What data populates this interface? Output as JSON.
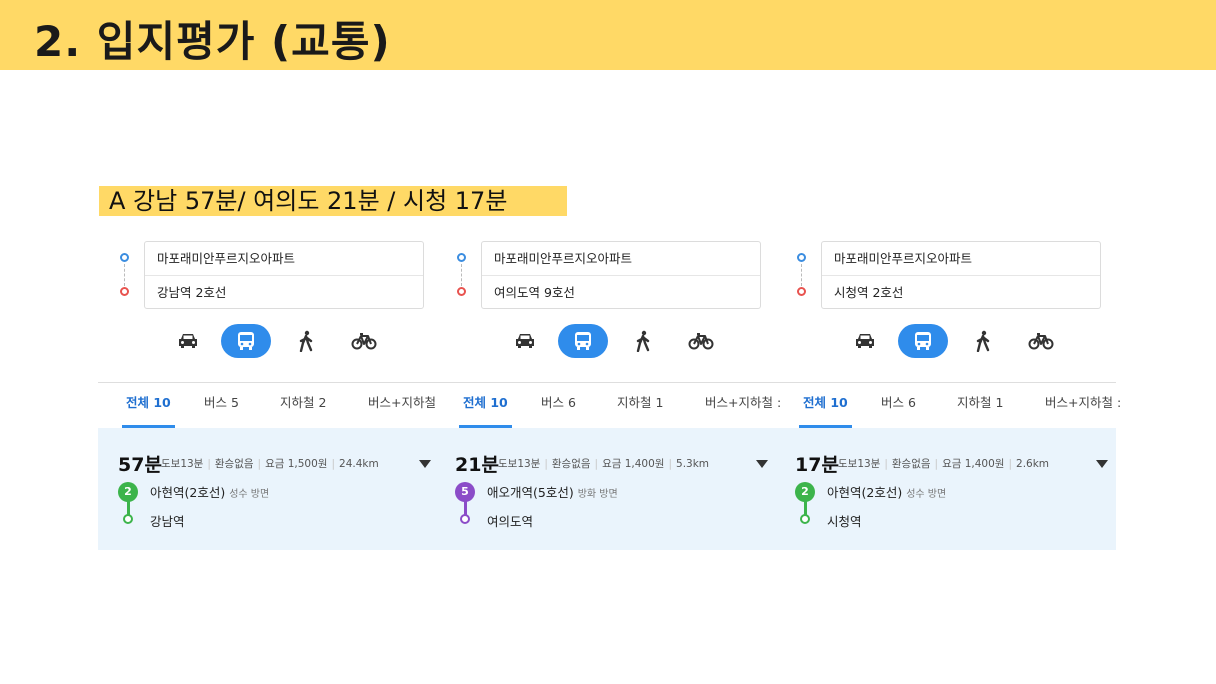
{
  "header": {
    "title": "2. 입지평가 (교통)"
  },
  "summary": {
    "text": "A 강남 57분/  여의도 21분  /  시청 17분"
  },
  "colors": {
    "header_bg": "#FFD966",
    "accent_blue": "#2F8CEB",
    "result_bg": "#EAF4FC",
    "origin_dot": "#3b8de0",
    "dest_dot": "#e8534f",
    "line2": "#3cb44b",
    "line5": "#8B4CC8"
  },
  "panels": [
    {
      "origin": "마포래미안푸르지오아파트",
      "destination": "강남역 2호선",
      "modes": [
        {
          "icon": "car-icon",
          "active": false
        },
        {
          "icon": "bus-icon",
          "active": true
        },
        {
          "icon": "walk-icon",
          "active": false
        },
        {
          "icon": "bicycle-icon",
          "active": false
        }
      ],
      "tabs": [
        "전체 10",
        "버스 5",
        "지하철 2",
        "버스+지하철"
      ],
      "result": {
        "time": "57분",
        "walk": "도보13분",
        "transfer": "환승없음",
        "fare": "요금 1,500원",
        "distance": "24.4km",
        "line_number": "2",
        "board_station": "아현역(2호선)",
        "direction": "성수 방면",
        "arrival_station": "강남역"
      }
    },
    {
      "origin": "마포래미안푸르지오아파트",
      "destination": "여의도역 9호선",
      "modes": [
        {
          "icon": "car-icon",
          "active": false
        },
        {
          "icon": "bus-icon",
          "active": true
        },
        {
          "icon": "walk-icon",
          "active": false
        },
        {
          "icon": "bicycle-icon",
          "active": false
        }
      ],
      "tabs": [
        "전체 10",
        "버스 6",
        "지하철 1",
        "버스+지하철 :"
      ],
      "result": {
        "time": "21분",
        "walk": "도보13분",
        "transfer": "환승없음",
        "fare": "요금 1,400원",
        "distance": "5.3km",
        "line_number": "5",
        "board_station": "애오개역(5호선)",
        "direction": "방화 방면",
        "arrival_station": "여의도역"
      }
    },
    {
      "origin": "마포래미안푸르지오아파트",
      "destination": "시청역 2호선",
      "modes": [
        {
          "icon": "car-icon",
          "active": false
        },
        {
          "icon": "bus-icon",
          "active": true
        },
        {
          "icon": "walk-icon",
          "active": false
        },
        {
          "icon": "bicycle-icon",
          "active": false
        }
      ],
      "tabs": [
        "전체 10",
        "버스 6",
        "지하철 1",
        "버스+지하철 :"
      ],
      "result": {
        "time": "17분",
        "walk": "도보13분",
        "transfer": "환승없음",
        "fare": "요금 1,400원",
        "distance": "2.6km",
        "line_number": "2",
        "board_station": "아현역(2호선)",
        "direction": "성수 방면",
        "arrival_station": "시청역"
      }
    }
  ]
}
